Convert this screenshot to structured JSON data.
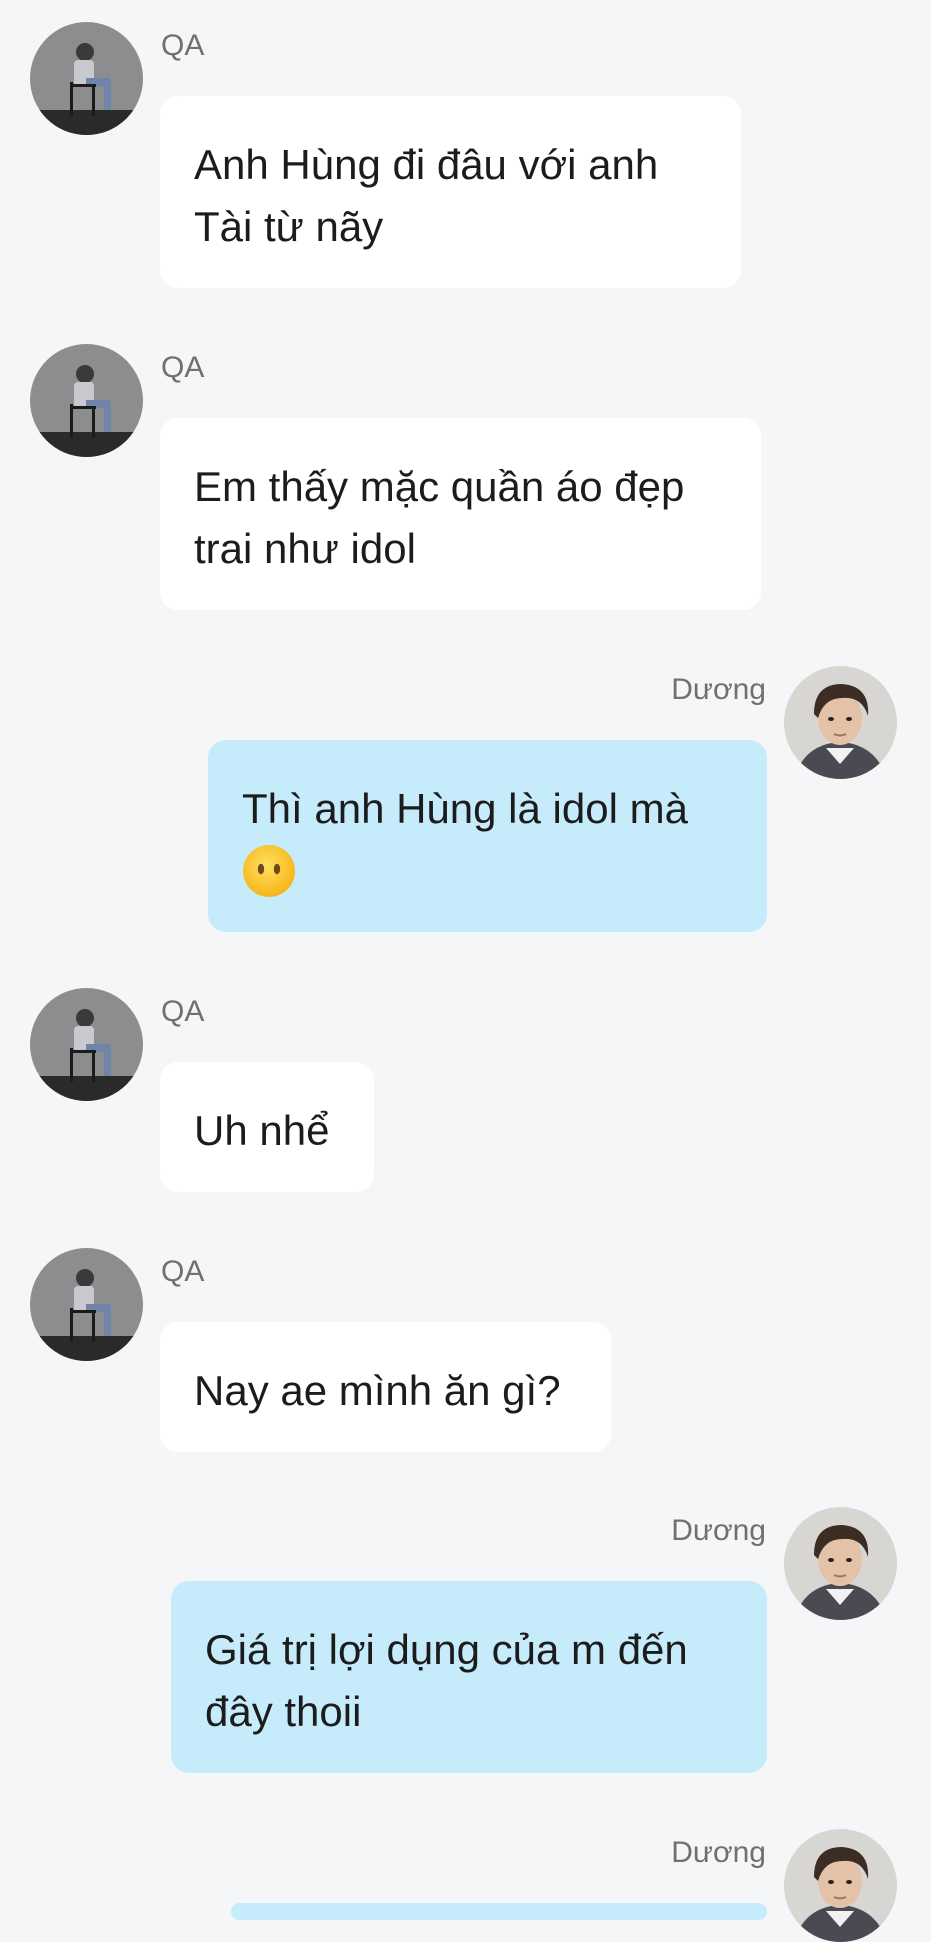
{
  "messages": [
    {
      "sender": "QA",
      "text": "Anh Hùng đi đâu với anh\nTài từ nãy"
    },
    {
      "sender": "QA",
      "text": "Em thấy mặc quần áo đẹp\ntrai như idol"
    },
    {
      "sender": "Dương",
      "text": "Thì anh Hùng là idol mà\n",
      "emoji": "face-without-mouth"
    },
    {
      "sender": "QA",
      "text": "Uh nhể"
    },
    {
      "sender": "QA",
      "text": "Nay ae mình ăn gì?"
    },
    {
      "sender": "Dương",
      "text": "Giá trị lợi dụng của m đến\nđây thoii"
    },
    {
      "sender": "Dương",
      "text": ""
    }
  ],
  "colors": {
    "background": "#f5f6f8",
    "incoming_bubble": "#ffffff",
    "outgoing_bubble": "#c6ebfb",
    "sender_name": "#707070",
    "message_text": "#1c1c1c"
  }
}
